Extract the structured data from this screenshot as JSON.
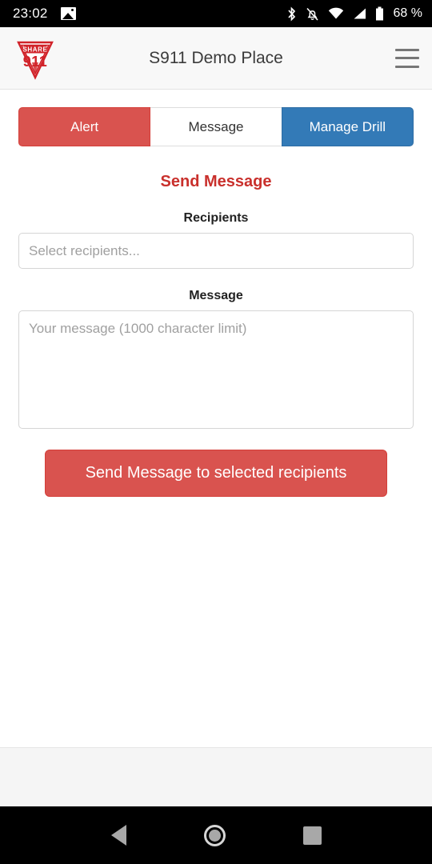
{
  "status_bar": {
    "time": "23:02",
    "battery_percent": "68 %",
    "icons": [
      "photo-icon",
      "bluetooth-icon",
      "notifications-off-icon",
      "wifi-icon",
      "cellular-signal-icon",
      "battery-icon"
    ]
  },
  "header": {
    "logo_top_text": "SHARE",
    "logo_bottom_text": "911",
    "title": "S911 Demo Place",
    "menu_icon": "hamburger-menu-icon"
  },
  "tabs": [
    {
      "label": "Alert",
      "style": "danger",
      "selected": false
    },
    {
      "label": "Message",
      "style": "default",
      "selected": true
    },
    {
      "label": "Manage Drill",
      "style": "primary",
      "selected": false
    }
  ],
  "form": {
    "title": "Send Message",
    "recipients": {
      "label": "Recipients",
      "placeholder": "Select recipients...",
      "value": ""
    },
    "message": {
      "label": "Message",
      "placeholder": "Your message (1000 character limit)",
      "value": ""
    },
    "submit_label": "Send Message to selected recipients"
  },
  "nav_bar": {
    "back": "back-nav-icon",
    "home": "home-nav-icon",
    "recents": "recents-nav-icon"
  },
  "colors": {
    "danger": "#d9534f",
    "primary": "#337ab7",
    "title_red": "#c9302c",
    "header_bg": "#f8f8f8",
    "footer_bg": "#f5f5f5"
  }
}
